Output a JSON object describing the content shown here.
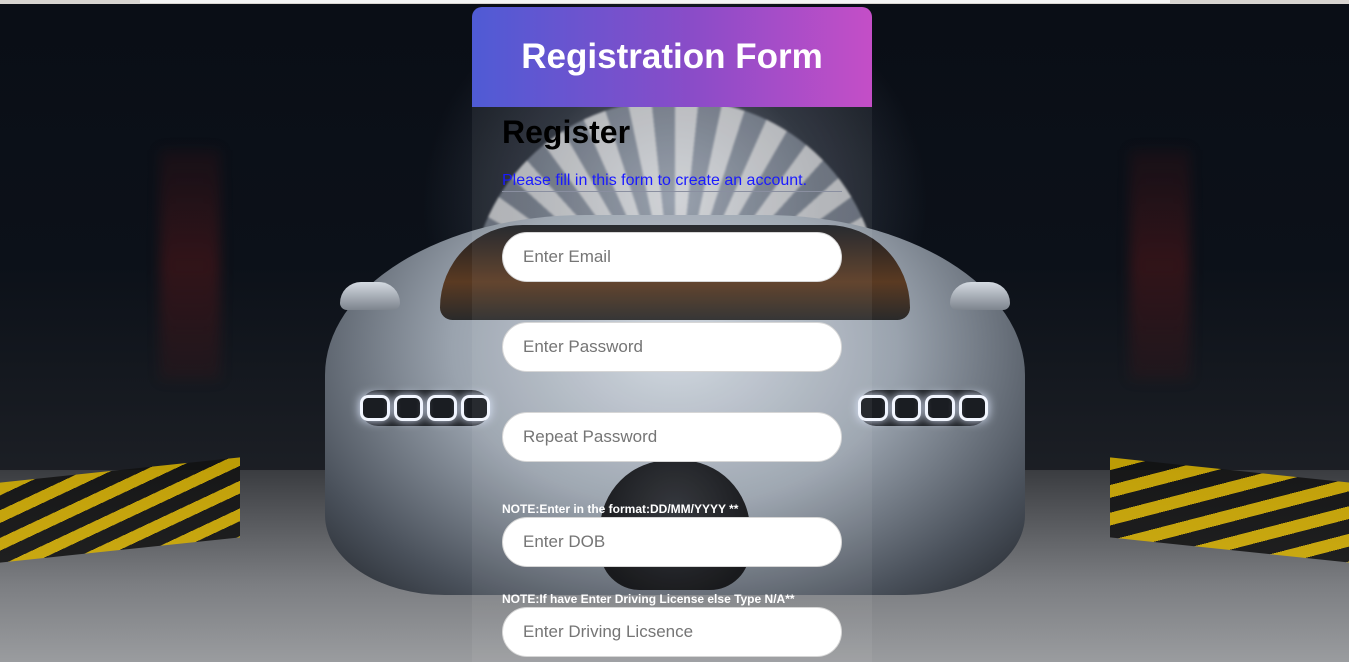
{
  "form": {
    "header_title": "Registration Form",
    "title": "Register",
    "subtitle": "Please fill in this form to create an account.",
    "fields": {
      "email_placeholder": "Enter Email",
      "password_placeholder": "Enter Password",
      "repeat_password_placeholder": "Repeat Password",
      "dob_placeholder": "Enter DOB",
      "license_placeholder": "Enter Driving Licsence"
    },
    "notes": {
      "dob_note": "NOTE:Enter in the format:DD/MM/YYYY **",
      "license_note": "NOTE:If have Enter Driving License else Type N/A**"
    }
  },
  "colors": {
    "header_gradient_start": "#4f5bd5",
    "header_gradient_end": "#c44ec7",
    "subtitle": "#1a1aff"
  }
}
